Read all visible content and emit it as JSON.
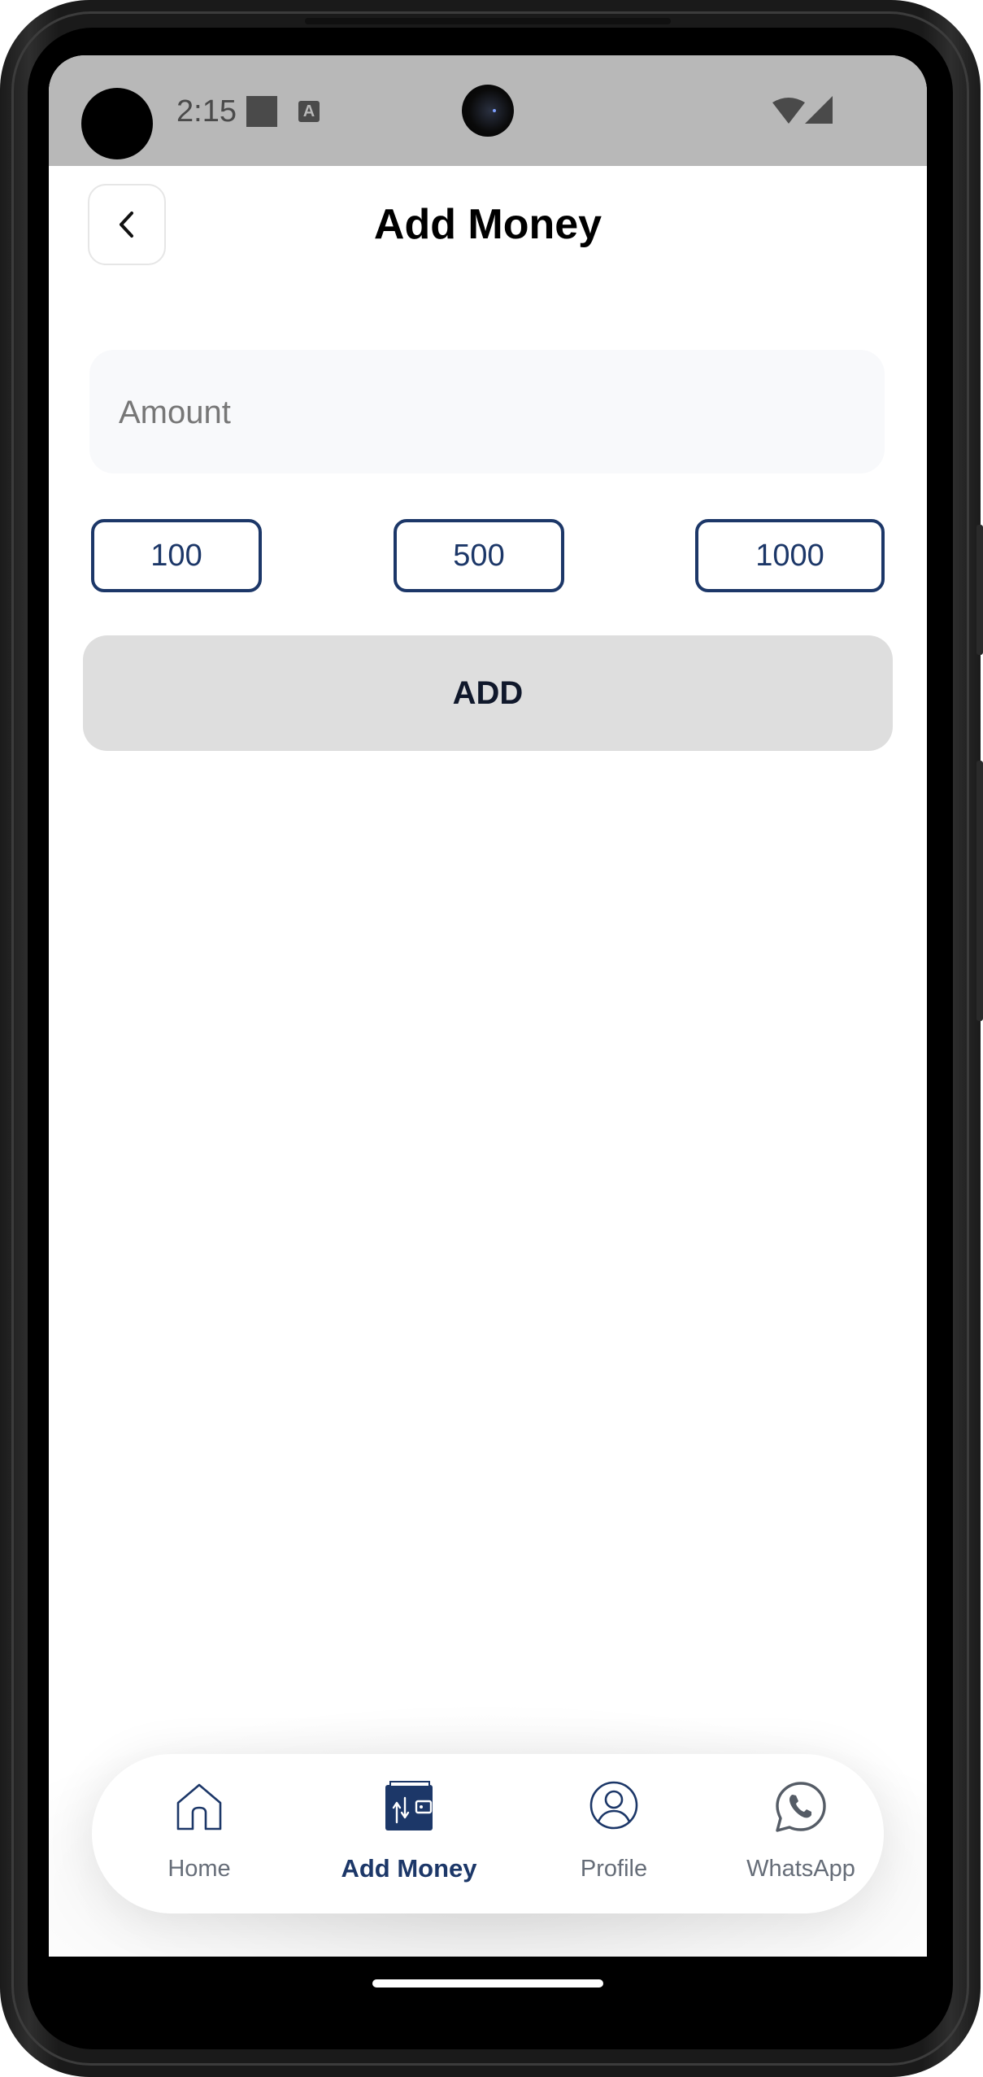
{
  "status_bar": {
    "time": "2:15",
    "notification_icon_letter": "A",
    "icons": [
      "notification-square-icon",
      "text-a-icon",
      "wifi-icon",
      "signal-icon"
    ]
  },
  "header": {
    "title": "Add Money",
    "back_icon": "chevron-left-icon"
  },
  "amount_input": {
    "placeholder": "Amount",
    "value": ""
  },
  "preset_amounts": [
    "100",
    "500",
    "1000"
  ],
  "add_button": {
    "label": "ADD"
  },
  "bottom_nav": {
    "items": [
      {
        "label": "Home",
        "icon": "home-icon",
        "active": false
      },
      {
        "label": "Add Money",
        "icon": "wallet-icon",
        "active": true
      },
      {
        "label": "Profile",
        "icon": "profile-icon",
        "active": false
      },
      {
        "label": "WhatsApp",
        "icon": "whatsapp-icon",
        "active": false
      }
    ]
  },
  "colors": {
    "primary": "#1c3768",
    "add_button_bg": "#dedede",
    "status_bar_bg": "#b8b8b8",
    "nav_inactive": "#666d78"
  }
}
